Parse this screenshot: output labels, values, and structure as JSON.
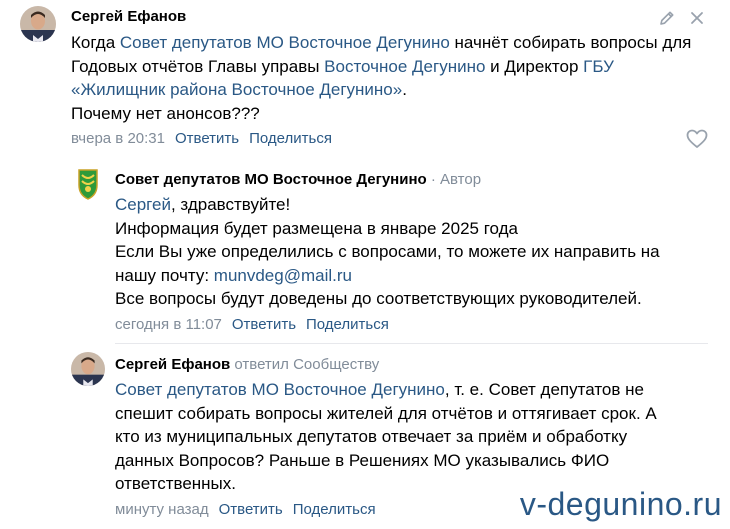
{
  "comment1": {
    "author": "Сергей Ефанов",
    "text_intro": "Когда ",
    "link_council": "Совет депутатов МО Восточное Дегунино",
    "text_mid1": " начнёт собирать вопросы для Годовых отчётов Главы управы ",
    "link_district": "Восточное Дегунино",
    "text_mid2": " и Директор ",
    "link_gbu": "ГБУ «Жилищник района Восточное Дегунино»",
    "text_end": ".",
    "question": "Почему нет анонсов???",
    "time": "вчера в 20:31",
    "reply_label": "Ответить",
    "share_label": "Поделиться",
    "edit_icon": "pencil-icon",
    "close_icon": "close-icon",
    "like_icon": "heart-icon"
  },
  "comment2": {
    "author": "Совет депутатов МО Восточное Дегунино",
    "author_suffix": " · Автор",
    "greeting_link": "Сергей",
    "greeting_rest": ", здравствуйте!",
    "line2": "Информация будет размещена в январе 2025 года",
    "line3": "Если Вы уже определились с вопросами, то можете их направить на нашу почту: ",
    "email": "munvdeg@mail.ru",
    "line4": "Все вопросы будут доведены до соответствующих руководителей.",
    "time": "сегодня в 11:07",
    "reply_label": "Ответить",
    "share_label": "Поделиться"
  },
  "comment3": {
    "author": "Сергей Ефанов",
    "replied": " ответил Сообществу",
    "link_council": "Совет депутатов МО Восточное Дегунино",
    "text": ", т. е. Совет депутатов не спешит собирать вопросы жителей для отчётов и оттягивает срок. А кто из муниципальных депутатов отвечает за приём и обработку данных Вопросов? Раньше в Решениях МО указывались ФИО ответственных.",
    "time": "минуту назад",
    "reply_label": "Ответить",
    "share_label": "Поделиться"
  },
  "watermark": "v-degunino.ru",
  "colors": {
    "link": "#2a5885",
    "muted": "#818c99",
    "divider": "#e7e8ec"
  }
}
